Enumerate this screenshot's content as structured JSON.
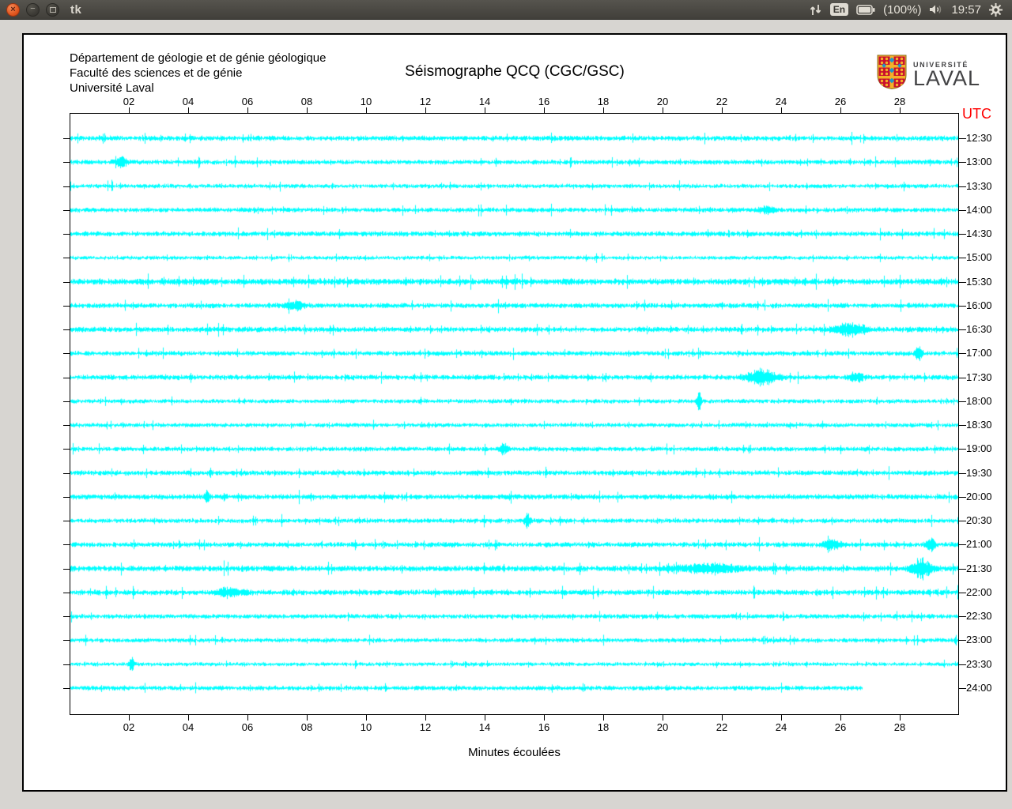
{
  "panel": {
    "window_title": "tk",
    "keyboard_layout": "En",
    "battery_label": "(100%)",
    "clock": "19:57"
  },
  "header": {
    "line1": "Département de géologie et de génie géologique",
    "line2": "Faculté des sciences et de génie",
    "line3": "Université Laval",
    "title": "Séismographe QCQ (CGC/GSC)"
  },
  "logo": {
    "line1": "UNIVERSITÉ",
    "line2": "LAVAL",
    "shield_gold": "#f3b229",
    "shield_red": "#c8102e",
    "shield_blue": "#2196c9"
  },
  "chart_data": {
    "type": "line",
    "subtype": "seismogram-helicorder",
    "title": "Séismographe QCQ (CGC/GSC)",
    "xlabel": "Minutes écoulées",
    "utc_header": "UTC",
    "utc_header_color": "#ff0000",
    "trace_color": "#00ffff",
    "x_range_minutes": [
      0,
      30
    ],
    "x_ticks": [
      "02",
      "04",
      "06",
      "08",
      "10",
      "12",
      "14",
      "16",
      "18",
      "20",
      "22",
      "24",
      "26",
      "28"
    ],
    "x_tick_minutes": [
      2,
      4,
      6,
      8,
      10,
      12,
      14,
      16,
      18,
      20,
      22,
      24,
      26,
      28
    ],
    "grid": false,
    "rows": [
      {
        "utc": "12:30"
      },
      {
        "utc": "13:00"
      },
      {
        "utc": "13:30"
      },
      {
        "utc": "14:00"
      },
      {
        "utc": "14:30"
      },
      {
        "utc": "15:00"
      },
      {
        "utc": "15:30"
      },
      {
        "utc": "16:00"
      },
      {
        "utc": "16:30"
      },
      {
        "utc": "17:00"
      },
      {
        "utc": "17:30"
      },
      {
        "utc": "18:00"
      },
      {
        "utc": "18:30"
      },
      {
        "utc": "19:00"
      },
      {
        "utc": "19:30"
      },
      {
        "utc": "20:00"
      },
      {
        "utc": "20:30"
      },
      {
        "utc": "21:00"
      },
      {
        "utc": "21:30"
      },
      {
        "utc": "22:00"
      },
      {
        "utc": "22:30"
      },
      {
        "utc": "23:00"
      },
      {
        "utc": "23:30"
      },
      {
        "utc": "24:00",
        "end_minute": 26.7
      }
    ],
    "base_amplitudes": [
      2.2,
      2.0,
      1.8,
      2.0,
      2.2,
      1.6,
      2.8,
      2.2,
      2.3,
      2.0,
      2.2,
      1.8,
      1.8,
      2.0,
      2.2,
      2.3,
      2.0,
      2.2,
      2.6,
      2.4,
      2.0,
      1.8,
      1.6,
      2.0
    ],
    "events": [
      {
        "row": 1,
        "minute": 1.7,
        "amp": 6,
        "width": 0.12
      },
      {
        "row": 3,
        "minute": 23.5,
        "amp": 4,
        "width": 0.2
      },
      {
        "row": 7,
        "minute": 7.6,
        "amp": 4,
        "width": 0.2
      },
      {
        "row": 8,
        "minute": 26.3,
        "amp": 6,
        "width": 0.4
      },
      {
        "row": 9,
        "minute": 28.6,
        "amp": 7,
        "width": 0.08
      },
      {
        "row": 10,
        "minute": 23.3,
        "amp": 8,
        "width": 0.35
      },
      {
        "row": 10,
        "minute": 26.5,
        "amp": 5,
        "width": 0.15
      },
      {
        "row": 11,
        "minute": 21.2,
        "amp": 9,
        "width": 0.06
      },
      {
        "row": 13,
        "minute": 14.6,
        "amp": 5,
        "width": 0.1
      },
      {
        "row": 15,
        "minute": 4.6,
        "amp": 9,
        "width": 0.05
      },
      {
        "row": 16,
        "minute": 15.4,
        "amp": 9,
        "width": 0.06
      },
      {
        "row": 17,
        "minute": 25.7,
        "amp": 5,
        "width": 0.2
      },
      {
        "row": 17,
        "minute": 29.0,
        "amp": 7,
        "width": 0.1
      },
      {
        "row": 18,
        "minute": 21.5,
        "amp": 4,
        "width": 0.8
      },
      {
        "row": 18,
        "minute": 28.7,
        "amp": 11,
        "width": 0.22
      },
      {
        "row": 19,
        "minute": 5.3,
        "amp": 4,
        "width": 0.3
      },
      {
        "row": 22,
        "minute": 2.05,
        "amp": 7,
        "width": 0.06
      }
    ]
  }
}
